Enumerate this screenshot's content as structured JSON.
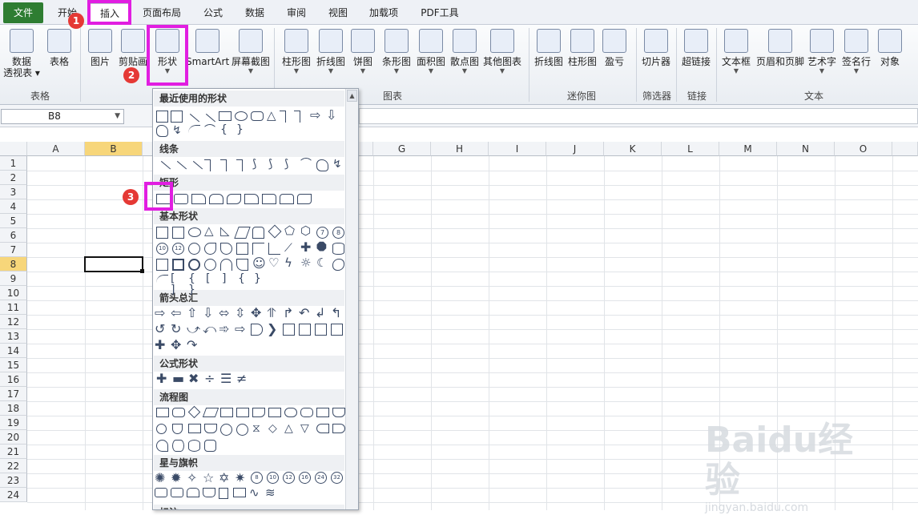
{
  "tabs": [
    "文件",
    "开始",
    "插入",
    "页面布局",
    "公式",
    "数据",
    "审阅",
    "视图",
    "加载项",
    "PDF工具"
  ],
  "ribbon": {
    "buttons": [
      {
        "l1": "数据",
        "l2": "透视表 ▾",
        "icon": "pivot-table-icon"
      },
      {
        "l1": "表格",
        "l2": "",
        "icon": "table-icon"
      },
      {
        "l1": "图片",
        "l2": "",
        "icon": "picture-icon"
      },
      {
        "l1": "剪贴画",
        "l2": "",
        "icon": "clipart-icon"
      },
      {
        "l1": "形状",
        "l2": "",
        "icon": "shapes-icon"
      },
      {
        "l1": "SmartArt",
        "l2": "",
        "icon": "smartart-icon"
      },
      {
        "l1": "屏幕截图",
        "l2": "",
        "icon": "screenshot-icon"
      },
      {
        "l1": "柱形图",
        "l2": "",
        "icon": "column-chart-icon"
      },
      {
        "l1": "折线图",
        "l2": "",
        "icon": "line-chart-icon"
      },
      {
        "l1": "饼图",
        "l2": "",
        "icon": "pie-chart-icon"
      },
      {
        "l1": "条形图",
        "l2": "",
        "icon": "bar-chart-icon"
      },
      {
        "l1": "面积图",
        "l2": "",
        "icon": "area-chart-icon"
      },
      {
        "l1": "散点图",
        "l2": "",
        "icon": "scatter-chart-icon"
      },
      {
        "l1": "其他图表",
        "l2": "",
        "icon": "other-charts-icon"
      },
      {
        "l1": "折线图",
        "l2": "",
        "icon": "sparkline-line-icon"
      },
      {
        "l1": "柱形图",
        "l2": "",
        "icon": "sparkline-column-icon"
      },
      {
        "l1": "盈亏",
        "l2": "",
        "icon": "sparkline-winloss-icon"
      },
      {
        "l1": "切片器",
        "l2": "",
        "icon": "slicer-icon"
      },
      {
        "l1": "超链接",
        "l2": "",
        "icon": "hyperlink-icon"
      },
      {
        "l1": "文本框",
        "l2": "",
        "icon": "textbox-icon"
      },
      {
        "l1": "页眉和页脚",
        "l2": "",
        "icon": "header-footer-icon"
      },
      {
        "l1": "艺术字",
        "l2": "",
        "icon": "wordart-icon"
      },
      {
        "l1": "签名行",
        "l2": "",
        "icon": "signature-icon"
      },
      {
        "l1": "对象",
        "l2": "",
        "icon": "object-icon"
      }
    ],
    "groups": [
      "表格",
      "图表",
      "迷你图",
      "筛选器",
      "链接",
      "文本"
    ]
  },
  "namebox": "B8",
  "fx": "fx",
  "columns": [
    "A",
    "B",
    "C",
    "D",
    "E",
    "F",
    "G",
    "H",
    "I",
    "J",
    "K",
    "L",
    "M",
    "N",
    "O"
  ],
  "rows": [
    "1",
    "2",
    "3",
    "4",
    "5",
    "6",
    "7",
    "8",
    "9",
    "10",
    "11",
    "12",
    "13",
    "14",
    "15",
    "16",
    "17",
    "18",
    "19",
    "20",
    "21",
    "22",
    "23",
    "24"
  ],
  "dropdown": {
    "sections": [
      "最近使用的形状",
      "线条",
      "矩形",
      "基本形状",
      "箭头总汇",
      "公式形状",
      "流程图",
      "星与旗帜",
      "标注"
    ]
  },
  "badges": [
    "1",
    "2",
    "3"
  ],
  "watermark": {
    "brand": "Baidu经验",
    "url": "jingyan.baidu.com"
  },
  "colors": {
    "highlight": "#e11ee1",
    "badge": "#e53935",
    "file_tab": "#2e7d32"
  }
}
